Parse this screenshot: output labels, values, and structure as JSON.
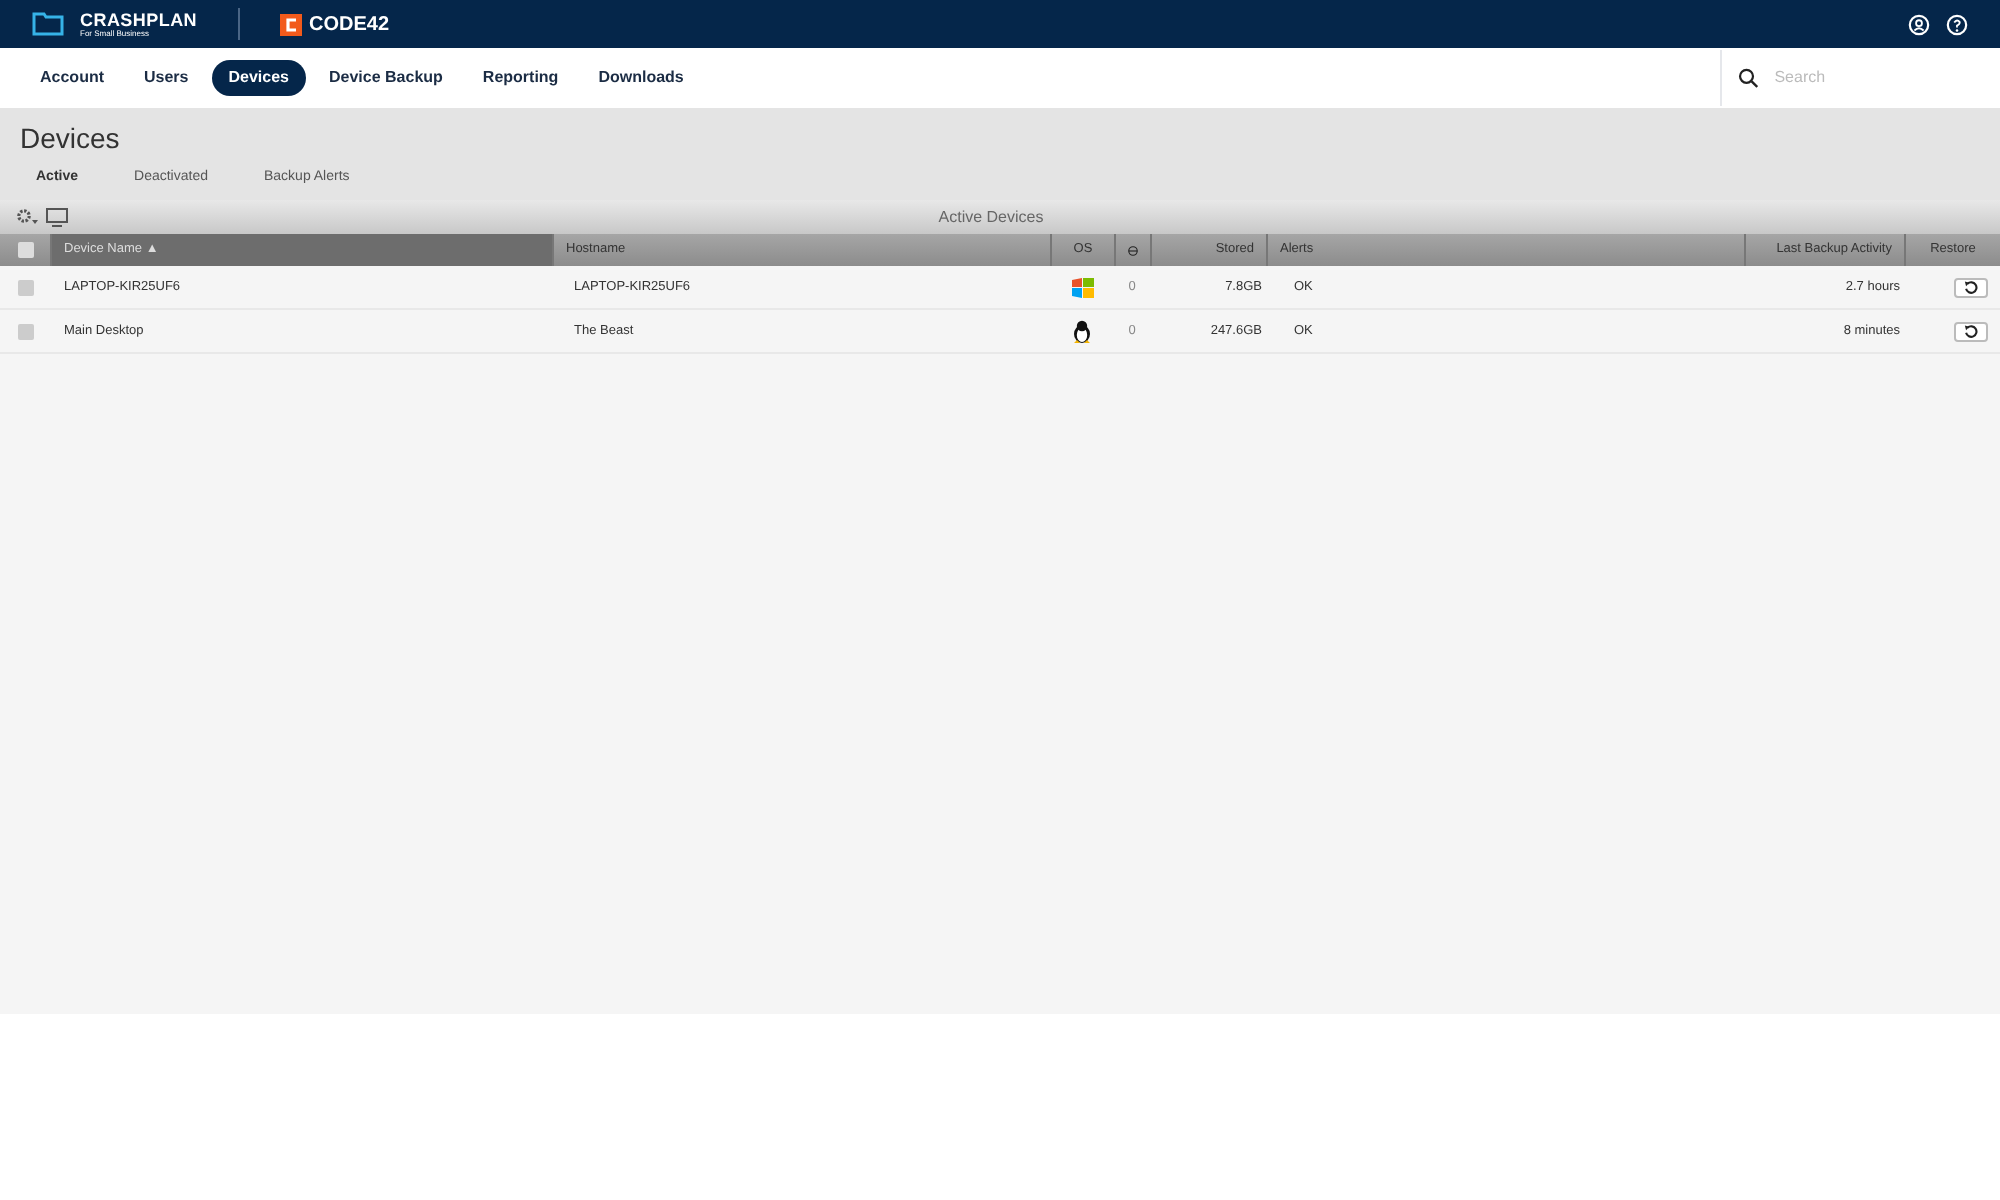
{
  "brand": {
    "name": "CRASHPLAN",
    "tagline": "For Small Business",
    "partner": "CODE42"
  },
  "nav": [
    {
      "label": "Account",
      "selected": false
    },
    {
      "label": "Users",
      "selected": false
    },
    {
      "label": "Devices",
      "selected": true
    },
    {
      "label": "Device Backup",
      "selected": false
    },
    {
      "label": "Reporting",
      "selected": false
    },
    {
      "label": "Downloads",
      "selected": false
    }
  ],
  "search": {
    "placeholder": "Search"
  },
  "page_title": "Devices",
  "subtabs": [
    {
      "label": "Active",
      "selected": true
    },
    {
      "label": "Deactivated",
      "selected": false
    },
    {
      "label": "Backup Alerts",
      "selected": false
    }
  ],
  "table": {
    "title": "Active Devices",
    "columns": [
      {
        "label": "Device Name ▲",
        "sorted": true
      },
      {
        "label": "Hostname",
        "sorted": false
      },
      {
        "label": "OS",
        "sorted": false
      },
      {
        "kind": "icon",
        "sorted": false
      },
      {
        "label": "Stored",
        "sorted": false
      },
      {
        "label": "Alerts",
        "sorted": false
      },
      {
        "label": "Last Backup Activity",
        "sorted": false
      },
      {
        "label": "Restore",
        "sorted": false
      }
    ],
    "select_all_checked": false,
    "rows": [
      {
        "checked": false,
        "name": "LAPTOP-KIR25UF6",
        "hostname": "LAPTOP-KIR25UF6",
        "kind": "windows",
        "count": "0",
        "stored": "7.8GB",
        "alerts": "OK",
        "last_backup": "2.7 hours"
      },
      {
        "checked": false,
        "name": "Main Desktop",
        "hostname": "The Beast",
        "kind": "linux",
        "count": "0",
        "stored": "247.6GB",
        "alerts": "OK",
        "last_backup": "8 minutes"
      }
    ]
  }
}
